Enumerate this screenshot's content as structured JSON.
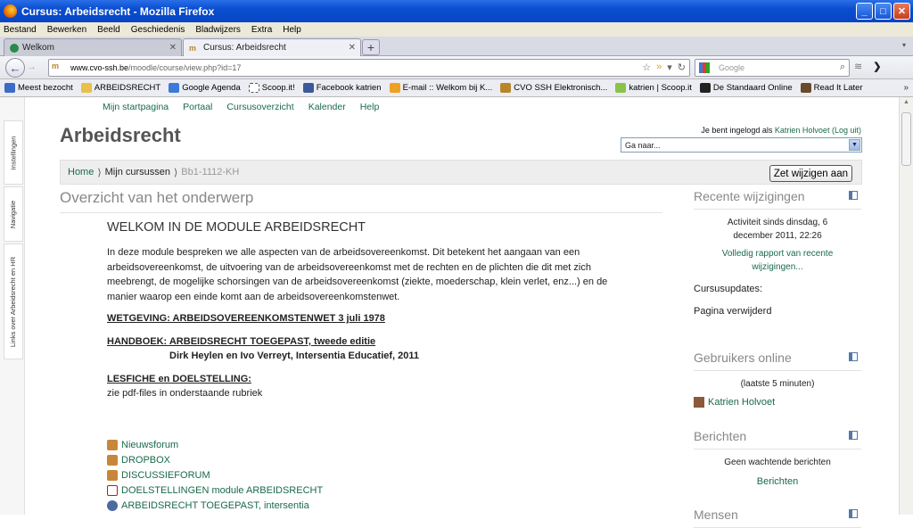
{
  "window": {
    "title": "Cursus: Arbeidsrecht - Mozilla Firefox"
  },
  "menu": [
    "Bestand",
    "Bewerken",
    "Beeld",
    "Geschiedenis",
    "Bladwijzers",
    "Extra",
    "Help"
  ],
  "tabs": [
    {
      "label": "Welkom",
      "active": false
    },
    {
      "label": "Cursus: Arbeidsrecht",
      "active": true
    }
  ],
  "url": {
    "host": "www.cvo-ssh.be",
    "path": "/moodle/course/view.php?id=17"
  },
  "search": {
    "placeholder": "Google"
  },
  "bookmarks": [
    {
      "label": "Meest bezocht",
      "color": "#3b6bc4"
    },
    {
      "label": "ARBEIDSRECHT",
      "color": "#e8c04a"
    },
    {
      "label": "Google Agenda",
      "color": "#3b7ad9"
    },
    {
      "label": "Scoop.it!",
      "color": "#ffffff"
    },
    {
      "label": "Facebook katrien",
      "color": "#3b5998"
    },
    {
      "label": "E-mail :: Welkom bij K...",
      "color": "#f0a020"
    },
    {
      "label": "CVO SSH Elektronisch...",
      "color": "#b8862a"
    },
    {
      "label": "katrien | Scoop.it",
      "color": "#8bc34a"
    },
    {
      "label": "De Standaard Online",
      "color": "#222222"
    },
    {
      "label": "Read It Later",
      "color": "#6a4a2a"
    }
  ],
  "dock": [
    "Instellingen",
    "Navigatie",
    "Links over Arbeidsrecht en HR"
  ],
  "topnav": [
    "Mijn startpagina",
    "Portaal",
    "Cursusoverzicht",
    "Kalender",
    "Help"
  ],
  "course": {
    "title": "Arbeidsrecht"
  },
  "login": {
    "prefix": "Je bent ingelogd als",
    "user": "Katrien Holvoet",
    "logout": "(Log uit)"
  },
  "goto": {
    "selected": "Ga naar..."
  },
  "breadcrumb": {
    "home": "Home",
    "mine": "Mijn cursussen",
    "current": "Bb1-1112-KH"
  },
  "edit_button": "Zet wijzigen aan",
  "main": {
    "heading": "Overzicht van het onderwerp",
    "welcome": "WELKOM IN DE MODULE ARBEIDSRECHT",
    "intro": "In deze module bespreken we alle aspecten van de arbeidsovereenkomst. Dit betekent het aangaan van een arbeidsovereenkomst, de uitvoering van de arbeidsovereenkomst met de rechten en de plichten die dit met zich meebrengt, de mogelijke schorsingen van de arbeidsovereenkomst (ziekte, moederschap, klein verlet, enz...) en de manier waarop een einde komt aan de arbeidsovereenkomstenwet.",
    "wetgeving": "WETGEVING:  ARBEIDSOVEREENKOMSTENWET 3 juli 1978",
    "handboek": "HANDBOEK: ARBEIDSRECHT TOEGEPAST, tweede editie",
    "handboek_sub": "Dirk Heylen en Ivo Verreyt,  Intersentia Educatief, 2011",
    "lesfiche": "LESFICHE en DOELSTELLING:",
    "lesfiche_sub": "zie pdf-files in onderstaande rubriek",
    "resources": [
      {
        "label": "Nieuwsforum",
        "icon": "forum-icon"
      },
      {
        "label": "DROPBOX",
        "icon": "forum-icon"
      },
      {
        "label": "DISCUSSIEFORUM",
        "icon": "forum-icon"
      },
      {
        "label": "DOELSTELLINGEN module ARBEIDSRECHT",
        "icon": "pdf-icon"
      },
      {
        "label": "ARBEIDSRECHT TOEGEPAST, intersentia",
        "icon": "link-icon"
      }
    ]
  },
  "recent": {
    "title": "Recente wijzigingen",
    "activity": "Activiteit sinds dinsdag, 6 december 2011, 22:26",
    "report": "Volledig rapport van recente wijzigingen...",
    "updates_label": "Cursusupdates:",
    "updates_value": "Pagina verwijderd"
  },
  "online": {
    "title": "Gebruikers online",
    "period": "(laatste 5 minuten)",
    "user": "Katrien Holvoet"
  },
  "messages": {
    "title": "Berichten",
    "none": "Geen wachtende berichten",
    "link": "Berichten"
  },
  "next_block": {
    "title": "Mensen"
  }
}
